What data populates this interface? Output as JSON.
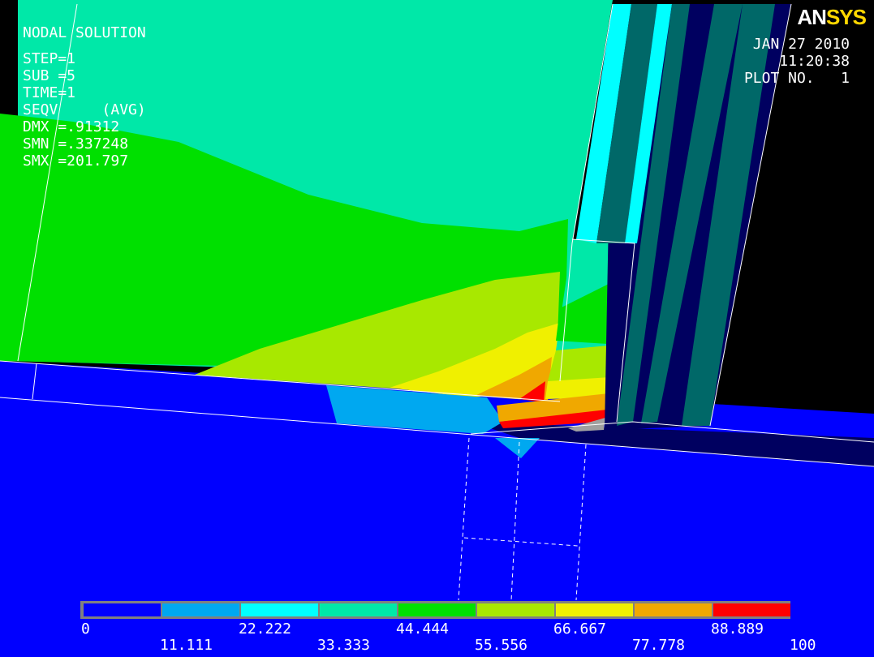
{
  "logo": {
    "part1": "AN",
    "part2": "SYS"
  },
  "info": {
    "title": "NODAL SOLUTION",
    "step": "STEP=1",
    "sub": "SUB =5",
    "time": "TIME=1",
    "seqv": "SEQV     (AVG)",
    "dmx": "DMX =.91312",
    "smn": "SMN =.337248",
    "smx": "SMX =201.797"
  },
  "header": {
    "date": "JAN 27 2010",
    "time": "11:20:38",
    "plot_no": "PLOT NO.   1"
  },
  "legend": {
    "colors": [
      "#0000ff",
      "#00a8f0",
      "#00ffff",
      "#00e8a8",
      "#00e000",
      "#a8e800",
      "#f0f000",
      "#f0a800",
      "#ff0000"
    ],
    "top_labels": [
      "0",
      "22.222",
      "44.444",
      "66.667",
      "88.889"
    ],
    "bottom_labels": [
      "11.111",
      "33.333",
      "55.556",
      "77.778",
      "100"
    ]
  },
  "colors": {
    "blue": "#0000ff",
    "lightblue": "#00a8f0",
    "cyan": "#00ffff",
    "aqua": "#00e8a8",
    "green": "#00e000",
    "yellowgreen": "#a8e800",
    "yellow": "#f0f000",
    "orange": "#f0a800",
    "red": "#ff0000",
    "navy": "#000060",
    "teal": "#006868",
    "gray": "#a0a0a0"
  }
}
